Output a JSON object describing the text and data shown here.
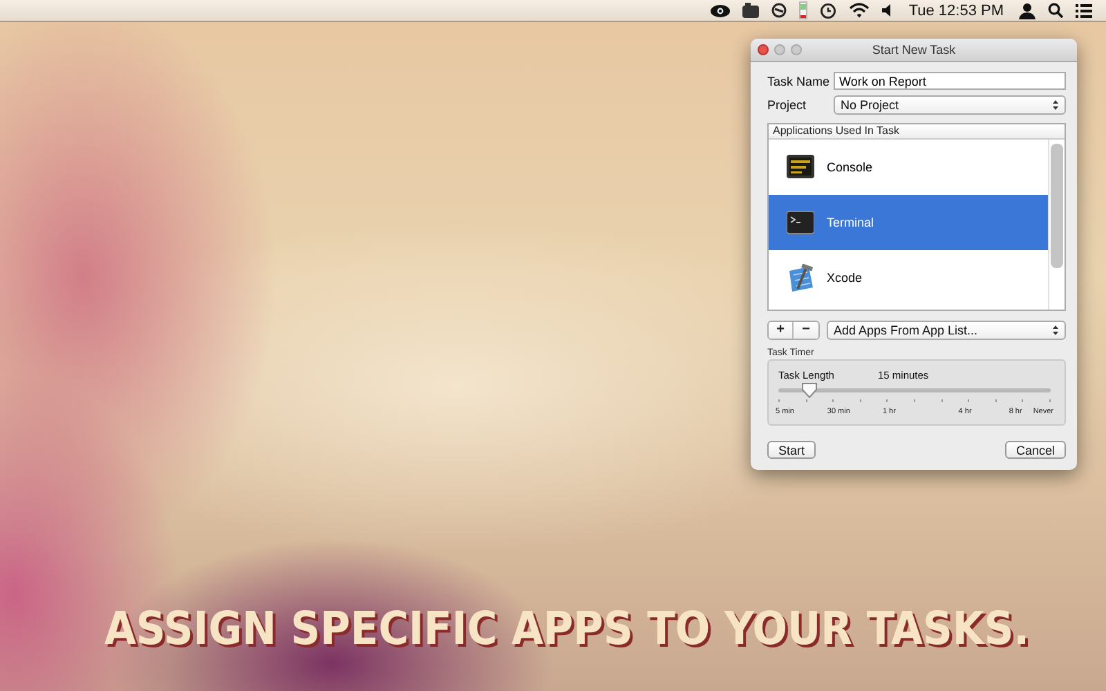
{
  "menu_bar": {
    "clock": "Tue 12:53 PM"
  },
  "window": {
    "title": "Start New Task",
    "task_name": {
      "label": "Task Name",
      "value": "Work on Report"
    },
    "project": {
      "label": "Project",
      "value": "No Project"
    },
    "apps": {
      "header": "Applications Used In Task",
      "rows": [
        {
          "name": "Console",
          "kind": "console",
          "selected": false
        },
        {
          "name": "Terminal",
          "kind": "terminal",
          "selected": true
        },
        {
          "name": "Xcode",
          "kind": "xcode",
          "selected": false
        }
      ]
    },
    "add_button": "+",
    "remove_button": "−",
    "add_apps": "Add Apps From App List...",
    "timer": {
      "title": "Task Timer",
      "length_label": "Task Length",
      "length_value": "15 minutes",
      "level": 0.11,
      "ticks": [
        "5 min",
        "30 min",
        "1 hr",
        "4 hr",
        "8 hr",
        "Never"
      ]
    },
    "buttons": {
      "start": "Start",
      "cancel": "Cancel"
    }
  },
  "headline": "ASSIGN SPECIFIC APPS TO YOUR TASKS."
}
